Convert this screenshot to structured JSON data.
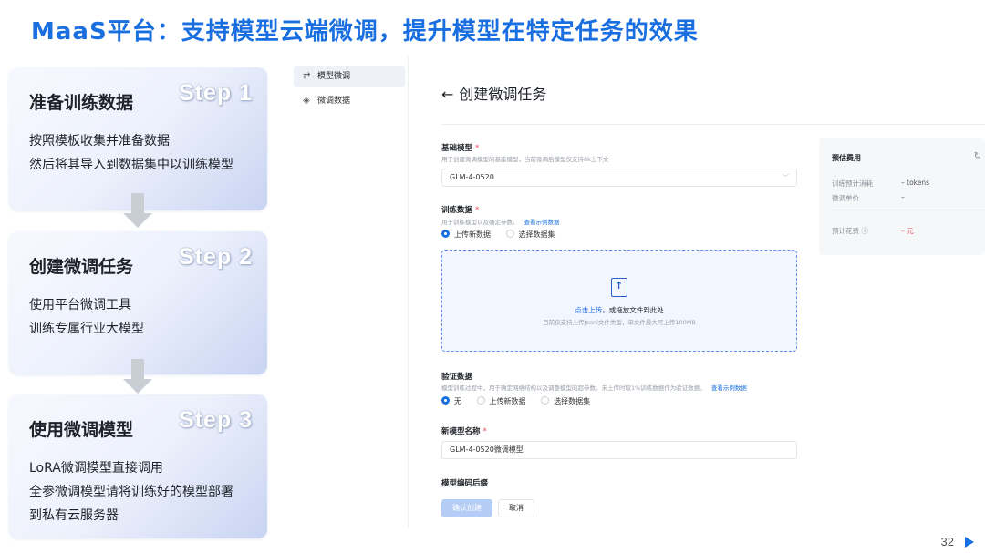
{
  "slide": {
    "title": "MaaS平台：支持模型云端微调，提升模型在特定任务的效果",
    "page_number": "32"
  },
  "steps": [
    {
      "name": "准备训练数据",
      "badge": "Step 1",
      "lines": [
        "按照模板收集并准备数据",
        "然后将其导入到数据集中以训练模型"
      ]
    },
    {
      "name": "创建微调任务",
      "badge": "Step 2",
      "lines": [
        "使用平台微调工具",
        "训练专属行业大模型"
      ]
    },
    {
      "name": "使用微调模型",
      "badge": "Step 3",
      "lines": [
        "LoRA微调模型直接调用",
        "全参微调模型请将训练好的模型部署",
        "到私有云服务器"
      ]
    }
  ],
  "sidebar": {
    "items": [
      {
        "label": "模型微调",
        "icon": "sliders-icon",
        "active": true
      },
      {
        "label": "微调数据",
        "icon": "layers-icon",
        "active": false
      }
    ]
  },
  "page": {
    "back_arrow": "←",
    "title": "创建微调任务"
  },
  "form": {
    "base_model": {
      "label": "基础模型",
      "required": "*",
      "hint": "用于创建微调模型的基座模型，当前微调后模型仅支持8k上下文",
      "value": "GLM-4-0520"
    },
    "train_data": {
      "label": "训练数据",
      "required": "*",
      "hint": "用于训练模型以及确定参数。",
      "hint_link": "查看示例数据",
      "options": [
        "上传新数据",
        "选择数据集"
      ],
      "selected": 0
    },
    "upload": {
      "link_text": "点击上传",
      "text": "，或拖放文件到此处",
      "sub": "目前仅支持上传Jsonl文件类型，单文件最大可上传100MB"
    },
    "val_data": {
      "label": "验证数据",
      "hint": "模型训练过程中，用于确定网络结构以及调整模型的超参数。未上传时取1%训练数据作为验证数据。",
      "hint_link": "查看示例数据",
      "options": [
        "无",
        "上传新数据",
        "选择数据集"
      ],
      "selected": 0
    },
    "new_model_name": {
      "label": "新模型名称",
      "required": "*",
      "value": "GLM-4-0520微调模型"
    },
    "model_suffix": {
      "label": "模型编码后缀"
    },
    "buttons": {
      "confirm": "确认创建",
      "cancel": "取消"
    }
  },
  "cost": {
    "title": "预估费用",
    "refresh_icon": "↻",
    "rows": [
      {
        "label": "训练预计消耗",
        "value": "– tokens"
      },
      {
        "label": "微调单价",
        "value": "–"
      }
    ],
    "total": {
      "label": "预计花费",
      "info_icon": "ⓘ",
      "value": "– 元"
    }
  },
  "colors": {
    "accent": "#1a6fe0",
    "danger": "#e34d59",
    "disabled_primary": "#b5cdf6"
  }
}
